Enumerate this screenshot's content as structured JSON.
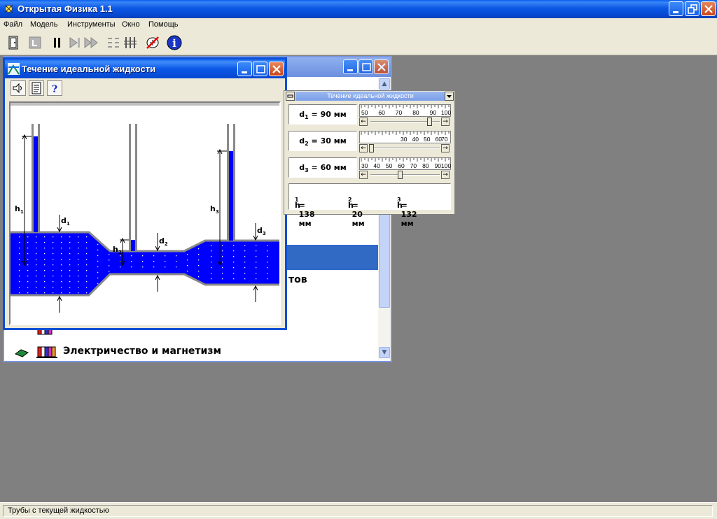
{
  "app": {
    "title": "Открытая Физика 1.1"
  },
  "menu": [
    "Файл",
    "Модель",
    "Инструменты",
    "Окно",
    "Помощь"
  ],
  "statusbar": {
    "text": "Трубы с текущей жидкостью"
  },
  "background_window": {
    "selected_row_partial_text": "тов",
    "list_item_label": "Электричество и магнетизм"
  },
  "sim_window": {
    "title": "Течение идеальной жидкости",
    "labels": {
      "h": "h",
      "d": "d",
      "i1": "1",
      "i2": "2",
      "i3": "3"
    }
  },
  "control_panel": {
    "title": "Течение идеальной жидкости",
    "params": [
      {
        "sym": "d",
        "idx": "1",
        "text": " = 90 мм",
        "scale": [
          "50",
          "60",
          "70",
          "80",
          "90",
          "100"
        ],
        "fraction": 0.86
      },
      {
        "sym": "d",
        "idx": "2",
        "text": " = 30 мм",
        "scale": [
          "30",
          "40",
          "50",
          "60",
          "70"
        ],
        "fraction": 0.0
      },
      {
        "sym": "d",
        "idx": "3",
        "text": " = 60 мм",
        "scale": [
          "30",
          "40",
          "50",
          "60",
          "70",
          "80",
          "90",
          "100"
        ],
        "fraction": 0.43
      }
    ],
    "heights": [
      {
        "sym": "h",
        "idx": "1",
        "text": " = 138 мм"
      },
      {
        "sym": "h",
        "idx": "2",
        "text": " = 20 мм"
      },
      {
        "sym": "h",
        "idx": "3",
        "text": " = 132 мм"
      }
    ]
  },
  "colors": {
    "fluid": "#0000ff",
    "title_blue": "#0a4fd6",
    "selection": "#316ac5"
  }
}
